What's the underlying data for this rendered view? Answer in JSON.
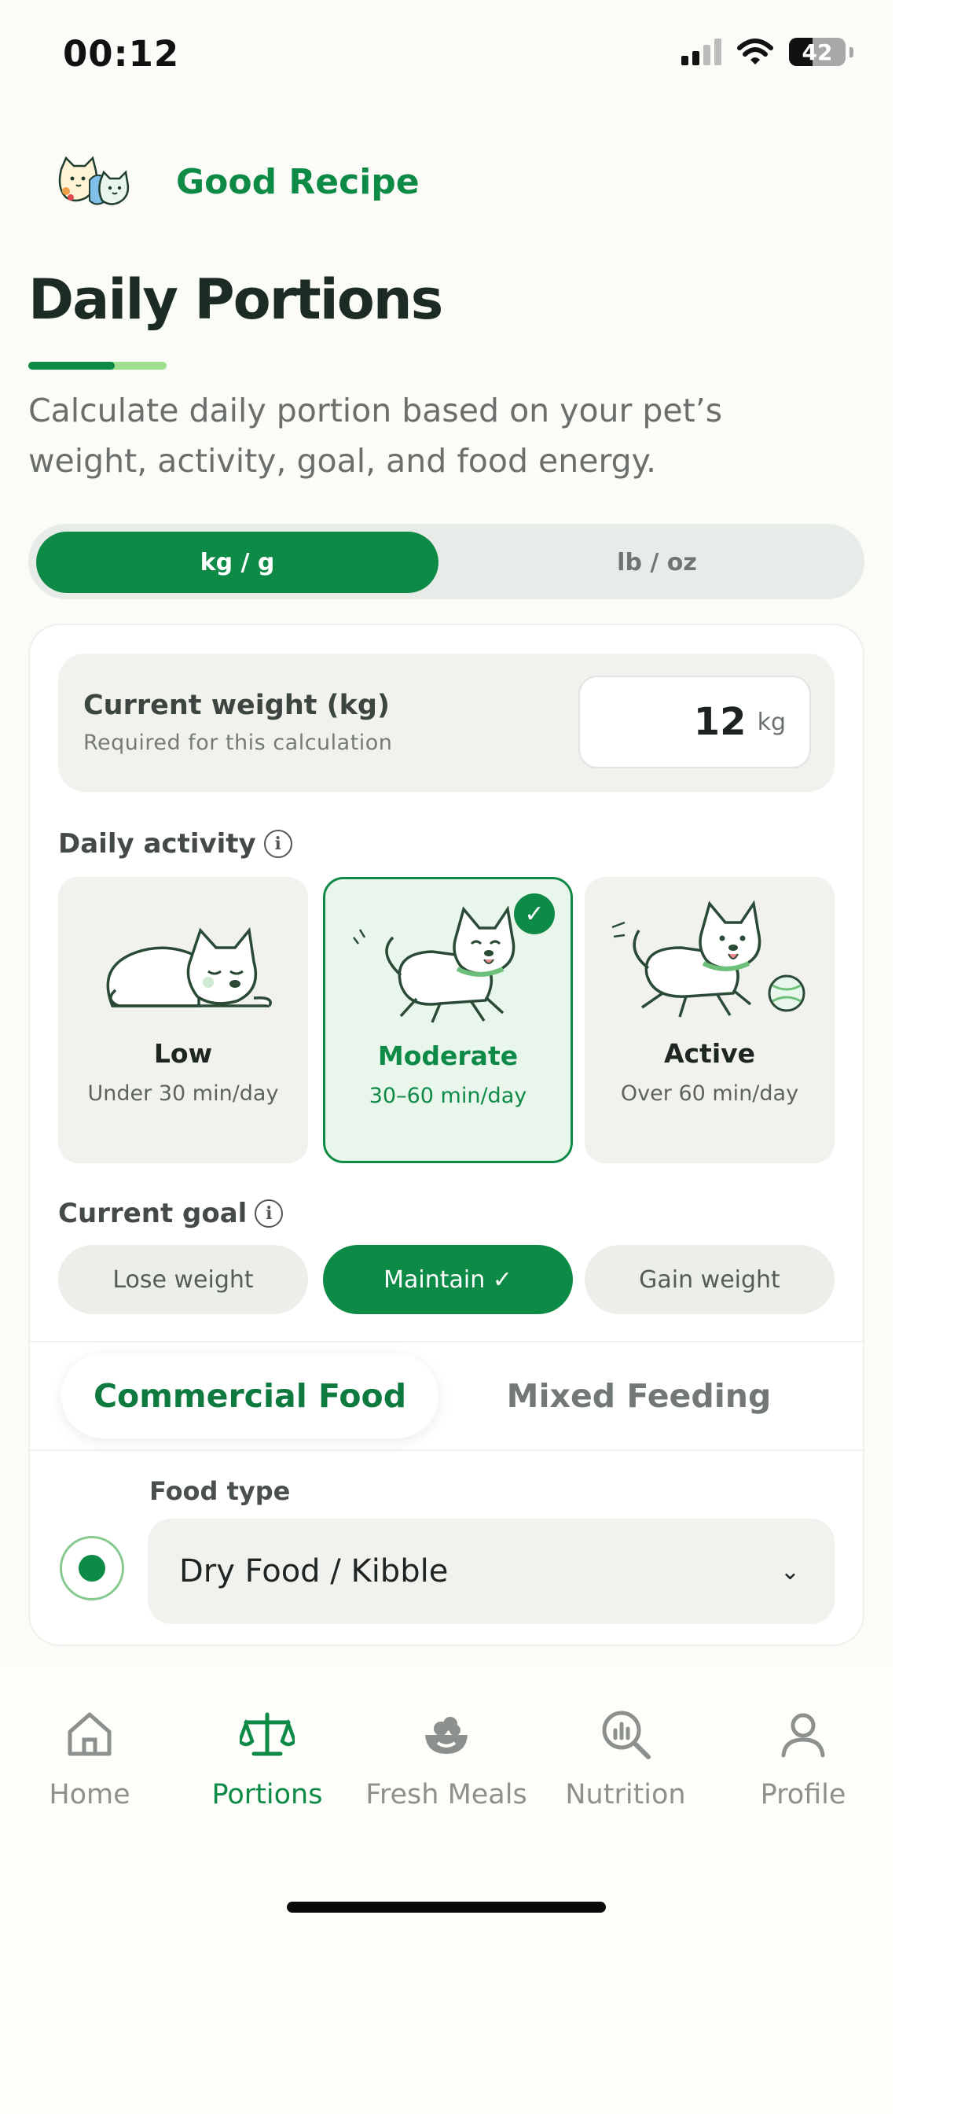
{
  "status_bar": {
    "time": "00:12",
    "battery": "42"
  },
  "brand": {
    "name": "Good Recipe",
    "logo_icon": "cat-and-dog-logo-icon"
  },
  "page": {
    "title": "Daily Portions",
    "subtitle": "Calculate daily portion based on your pet’s weight, activity, goal, and food energy."
  },
  "unit_toggle": {
    "options": [
      "kg / g",
      "lb / oz"
    ],
    "selected": "kg / g"
  },
  "weight": {
    "label": "Current weight (kg)",
    "hint": "Required for this calculation",
    "value": "12",
    "unit": "kg"
  },
  "activity": {
    "label": "Daily activity",
    "options": [
      {
        "title": "Low",
        "sub": "Under 30 min/day",
        "icon": "sleeping-dog-icon"
      },
      {
        "title": "Moderate",
        "sub": "30–60 min/day",
        "icon": "walking-dog-icon",
        "selected": true,
        "check": "✓"
      },
      {
        "title": "Active",
        "sub": "Over 60 min/day",
        "icon": "running-dog-with-ball-icon"
      }
    ]
  },
  "goal": {
    "label": "Current goal",
    "options": [
      "Lose weight",
      "Maintain ✓",
      "Gain weight"
    ],
    "selected": "Maintain ✓"
  },
  "feeding_tabs": {
    "tabs": [
      "Commercial Food",
      "Mixed Feeding"
    ],
    "selected": "Commercial Food"
  },
  "food_type": {
    "label": "Food type",
    "value": "Dry Food / Kibble",
    "chevron": "⌄"
  },
  "bottom_nav": {
    "items": [
      {
        "label": "Home",
        "icon": "home-icon"
      },
      {
        "label": "Portions",
        "icon": "scale-icon",
        "active": true
      },
      {
        "label": "Fresh Meals",
        "icon": "bowl-icon"
      },
      {
        "label": "Nutrition",
        "icon": "chart-magnifier-icon"
      },
      {
        "label": "Profile",
        "icon": "user-icon"
      }
    ]
  },
  "colors": {
    "accent": "#0e8a47",
    "accent_light": "#9ee08e",
    "background": "#fbfbf8"
  }
}
